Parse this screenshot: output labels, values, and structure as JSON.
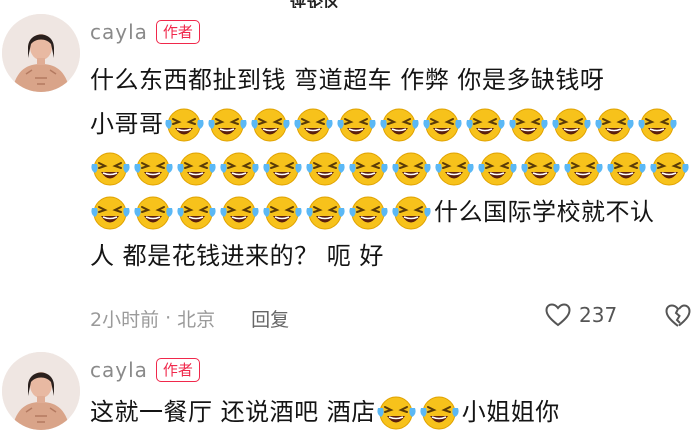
{
  "header_fragment": "评论区",
  "comments": [
    {
      "username": "cayla",
      "author_tag": "作者",
      "lines": [
        {
          "text": "什么东西都扯到钱 弯道超车 作弊 你是多缺钱呀",
          "emoji_after": 0
        },
        {
          "text": "小哥哥",
          "emoji_after": 12
        },
        {
          "text": "",
          "emoji_after": 14
        },
        {
          "text": "",
          "emoji_after": 8,
          "text_after": "什么国际学校就不认"
        },
        {
          "text": "人 都是花钱进来的？ 呃 好",
          "emoji_after": 0
        }
      ],
      "emoji_icon": "laughing-crying-emoji",
      "time": "2小时前",
      "separator": "·",
      "location": "北京",
      "reply_label": "回复",
      "like_icon": "heart-icon",
      "like_count": "237",
      "dislike_icon": "broken-heart-icon"
    },
    {
      "username": "cayla",
      "author_tag": "作者",
      "lines": [
        {
          "text": "这就一餐厅 还说酒吧 酒店",
          "emoji_after": 2,
          "text_after": "小姐姐你"
        }
      ],
      "emoji_icon": "laughing-crying-emoji"
    }
  ],
  "colors": {
    "author_tag": "#f0284b",
    "meta_text": "#9a9a9a",
    "body_text": "#141414"
  }
}
